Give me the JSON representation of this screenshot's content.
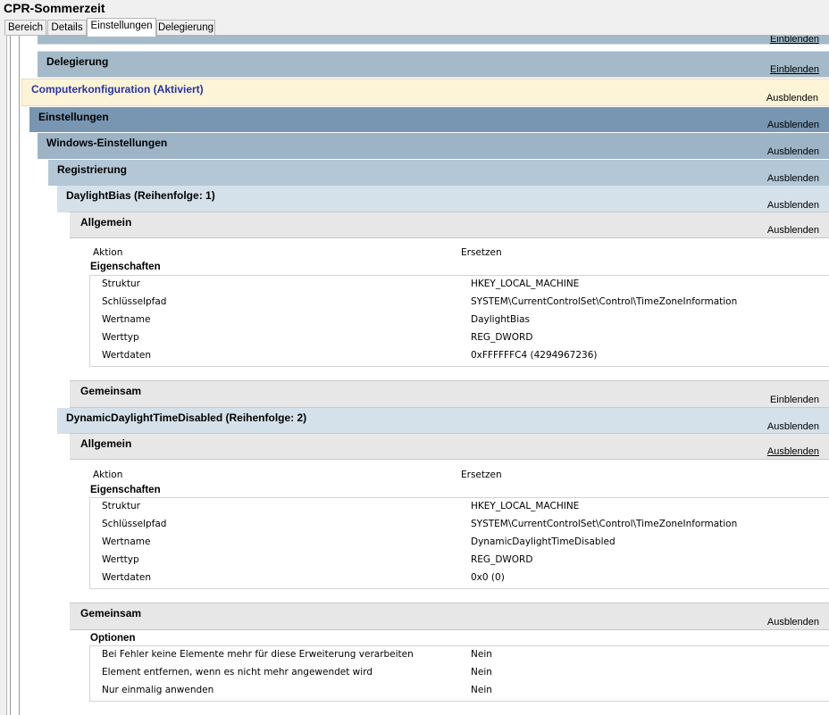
{
  "window": {
    "title": "CPR-Sommerzeit"
  },
  "tabs": [
    {
      "label": "Bereich"
    },
    {
      "label": "Details"
    },
    {
      "label": "Einstellungen"
    },
    {
      "label": "Delegierung"
    }
  ],
  "report": {
    "top_cut_toggle": "Einblenden",
    "delegierung": {
      "title": "Delegierung",
      "toggle": "Einblenden"
    },
    "computer": {
      "title": "Computerkonfiguration (Aktiviert)",
      "toggle": "Ausblenden"
    },
    "einstellungen": {
      "title": "Einstellungen",
      "toggle": "Ausblenden"
    },
    "windows_einstellungen": {
      "title": "Windows-Einstellungen",
      "toggle": "Ausblenden"
    },
    "registrierung": {
      "title": "Registrierung",
      "toggle": "Ausblenden"
    },
    "items": [
      {
        "title": "DaylightBias (Reihenfolge: 1)",
        "toggle": "Ausblenden",
        "allgemein": {
          "title": "Allgemein",
          "toggle": "Ausblenden"
        },
        "aktion_label": "Aktion",
        "aktion_value": "Ersetzen",
        "props_title": "Eigenschaften",
        "props": [
          {
            "k": "Struktur",
            "v": "HKEY_LOCAL_MACHINE"
          },
          {
            "k": "Schlüsselpfad",
            "v": "SYSTEM\\CurrentControlSet\\Control\\TimeZoneInformation"
          },
          {
            "k": "Wertname",
            "v": "DaylightBias"
          },
          {
            "k": "Werttyp",
            "v": "REG_DWORD"
          },
          {
            "k": "Wertdaten",
            "v": "0xFFFFFFC4 (4294967236)"
          }
        ],
        "gemeinsam": {
          "title": "Gemeinsam",
          "toggle": "Einblenden"
        }
      },
      {
        "title": "DynamicDaylightTimeDisabled (Reihenfolge: 2)",
        "toggle": "Ausblenden",
        "allgemein": {
          "title": "Allgemein",
          "toggle": "Ausblenden"
        },
        "aktion_label": "Aktion",
        "aktion_value": "Ersetzen",
        "props_title": "Eigenschaften",
        "props": [
          {
            "k": "Struktur",
            "v": "HKEY_LOCAL_MACHINE"
          },
          {
            "k": "Schlüsselpfad",
            "v": "SYSTEM\\CurrentControlSet\\Control\\TimeZoneInformation"
          },
          {
            "k": "Wertname",
            "v": "DynamicDaylightTimeDisabled"
          },
          {
            "k": "Werttyp",
            "v": "REG_DWORD"
          },
          {
            "k": "Wertdaten",
            "v": "0x0 (0)"
          }
        ],
        "gemeinsam": {
          "title": "Gemeinsam",
          "toggle": "Ausblenden"
        },
        "options_title": "Optionen",
        "options": [
          {
            "k": "Bei Fehler keine Elemente mehr für diese Erweiterung verarbeiten",
            "v": "Nein"
          },
          {
            "k": "Element entfernen, wenn es nicht mehr angewendet wird",
            "v": "Nein"
          },
          {
            "k": "Nur einmalig anwenden",
            "v": "Nein"
          }
        ]
      }
    ]
  }
}
